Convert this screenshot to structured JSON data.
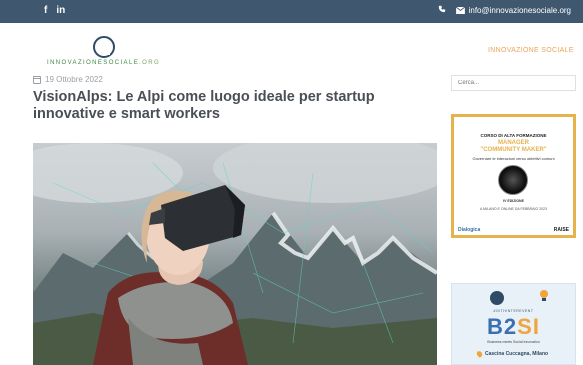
{
  "topbar": {
    "social": [
      "f",
      "in"
    ],
    "email": "info@innovazionesociale.org",
    "phone_icon": "phone-icon",
    "mail_icon": "envelope-icon"
  },
  "logo": {
    "wordmark_a": "INNOVAZIONESOCIALE",
    "wordmark_b": ".ORG"
  },
  "nav": {
    "item": "INNOVAZIONE SOCIALE"
  },
  "article": {
    "date": "19 Ottobre 2022",
    "title": "VisionAlps: Le Alpi come luogo ideale per startup innovative e smart workers"
  },
  "search": {
    "placeholder": "Cerca..."
  },
  "banner1": {
    "head": "CORSO DI ALTA FORMAZIONE",
    "title_1": "MANAGER",
    "title_2": "\"COMMUNITY MAKER\"",
    "sub": "Governare le interazioni verso obiettivi comuni",
    "edition": "IV EDIZIONE",
    "dates": "A MILANO E ONLINE DA FEBBRAIO 2023",
    "left_logo": "Dialogica",
    "right_logo": "RAISE"
  },
  "banner2": {
    "tagline": "#OITHINTEREVENT",
    "big_a": "B2",
    "big_b": "SI",
    "strap": "Business meets Social Innovation",
    "location": "Cascina Cuccagna, Milano"
  },
  "colors": {
    "topbar": "#3f5870",
    "accent": "#e9a45a",
    "title": "#4a4f55"
  }
}
